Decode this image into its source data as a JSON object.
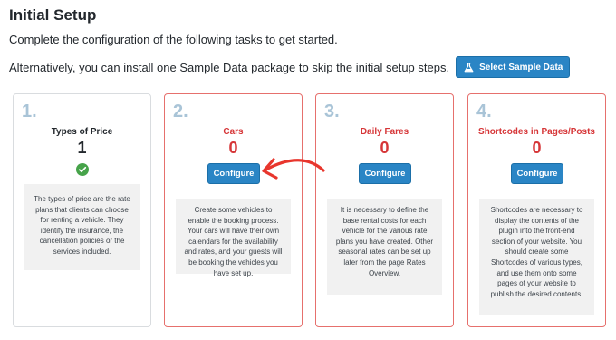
{
  "header": {
    "title": "Initial Setup",
    "intro": "Complete the configuration of the following tasks to get started.",
    "alt_text": "Alternatively, you can install one Sample Data package to skip the initial setup steps.",
    "sample_button_label": "Select Sample Data"
  },
  "colors": {
    "primary_button": "#2a85c5",
    "pending_red": "#d63638",
    "pending_border": "#e6706d",
    "done_green": "#46a34a",
    "step_number": "#a9c4d7",
    "annotation_arrow": "#e8362d"
  },
  "cards": [
    {
      "number": "1.",
      "title": "Types of Price",
      "count": "1",
      "status": "complete",
      "icon": "check-circle-icon",
      "description": "The types of price are the rate plans that clients can choose for renting a vehicle. They identify the insurance, the cancellation policies or the services included."
    },
    {
      "number": "2.",
      "title": "Cars",
      "count": "0",
      "status": "pending",
      "button_label": "Configure",
      "description": "Create some vehicles to enable the booking process. Your cars will have their own calendars for the availability and rates, and your guests will be booking the vehicles you have set up."
    },
    {
      "number": "3.",
      "title": "Daily Fares",
      "count": "0",
      "status": "pending",
      "button_label": "Configure",
      "description": "It is necessary to define the base rental costs for each vehicle for the various rate plans you have created. Other seasonal rates can be set up later from the page Rates Overview."
    },
    {
      "number": "4.",
      "title": "Shortcodes in Pages/Posts",
      "count": "0",
      "status": "pending",
      "button_label": "Configure",
      "description": "Shortcodes are necessary to display the contents of the plugin into the front-end section of your website. You should create some Shortcodes of various types, and use them onto some pages of your website to publish the desired contents."
    }
  ]
}
